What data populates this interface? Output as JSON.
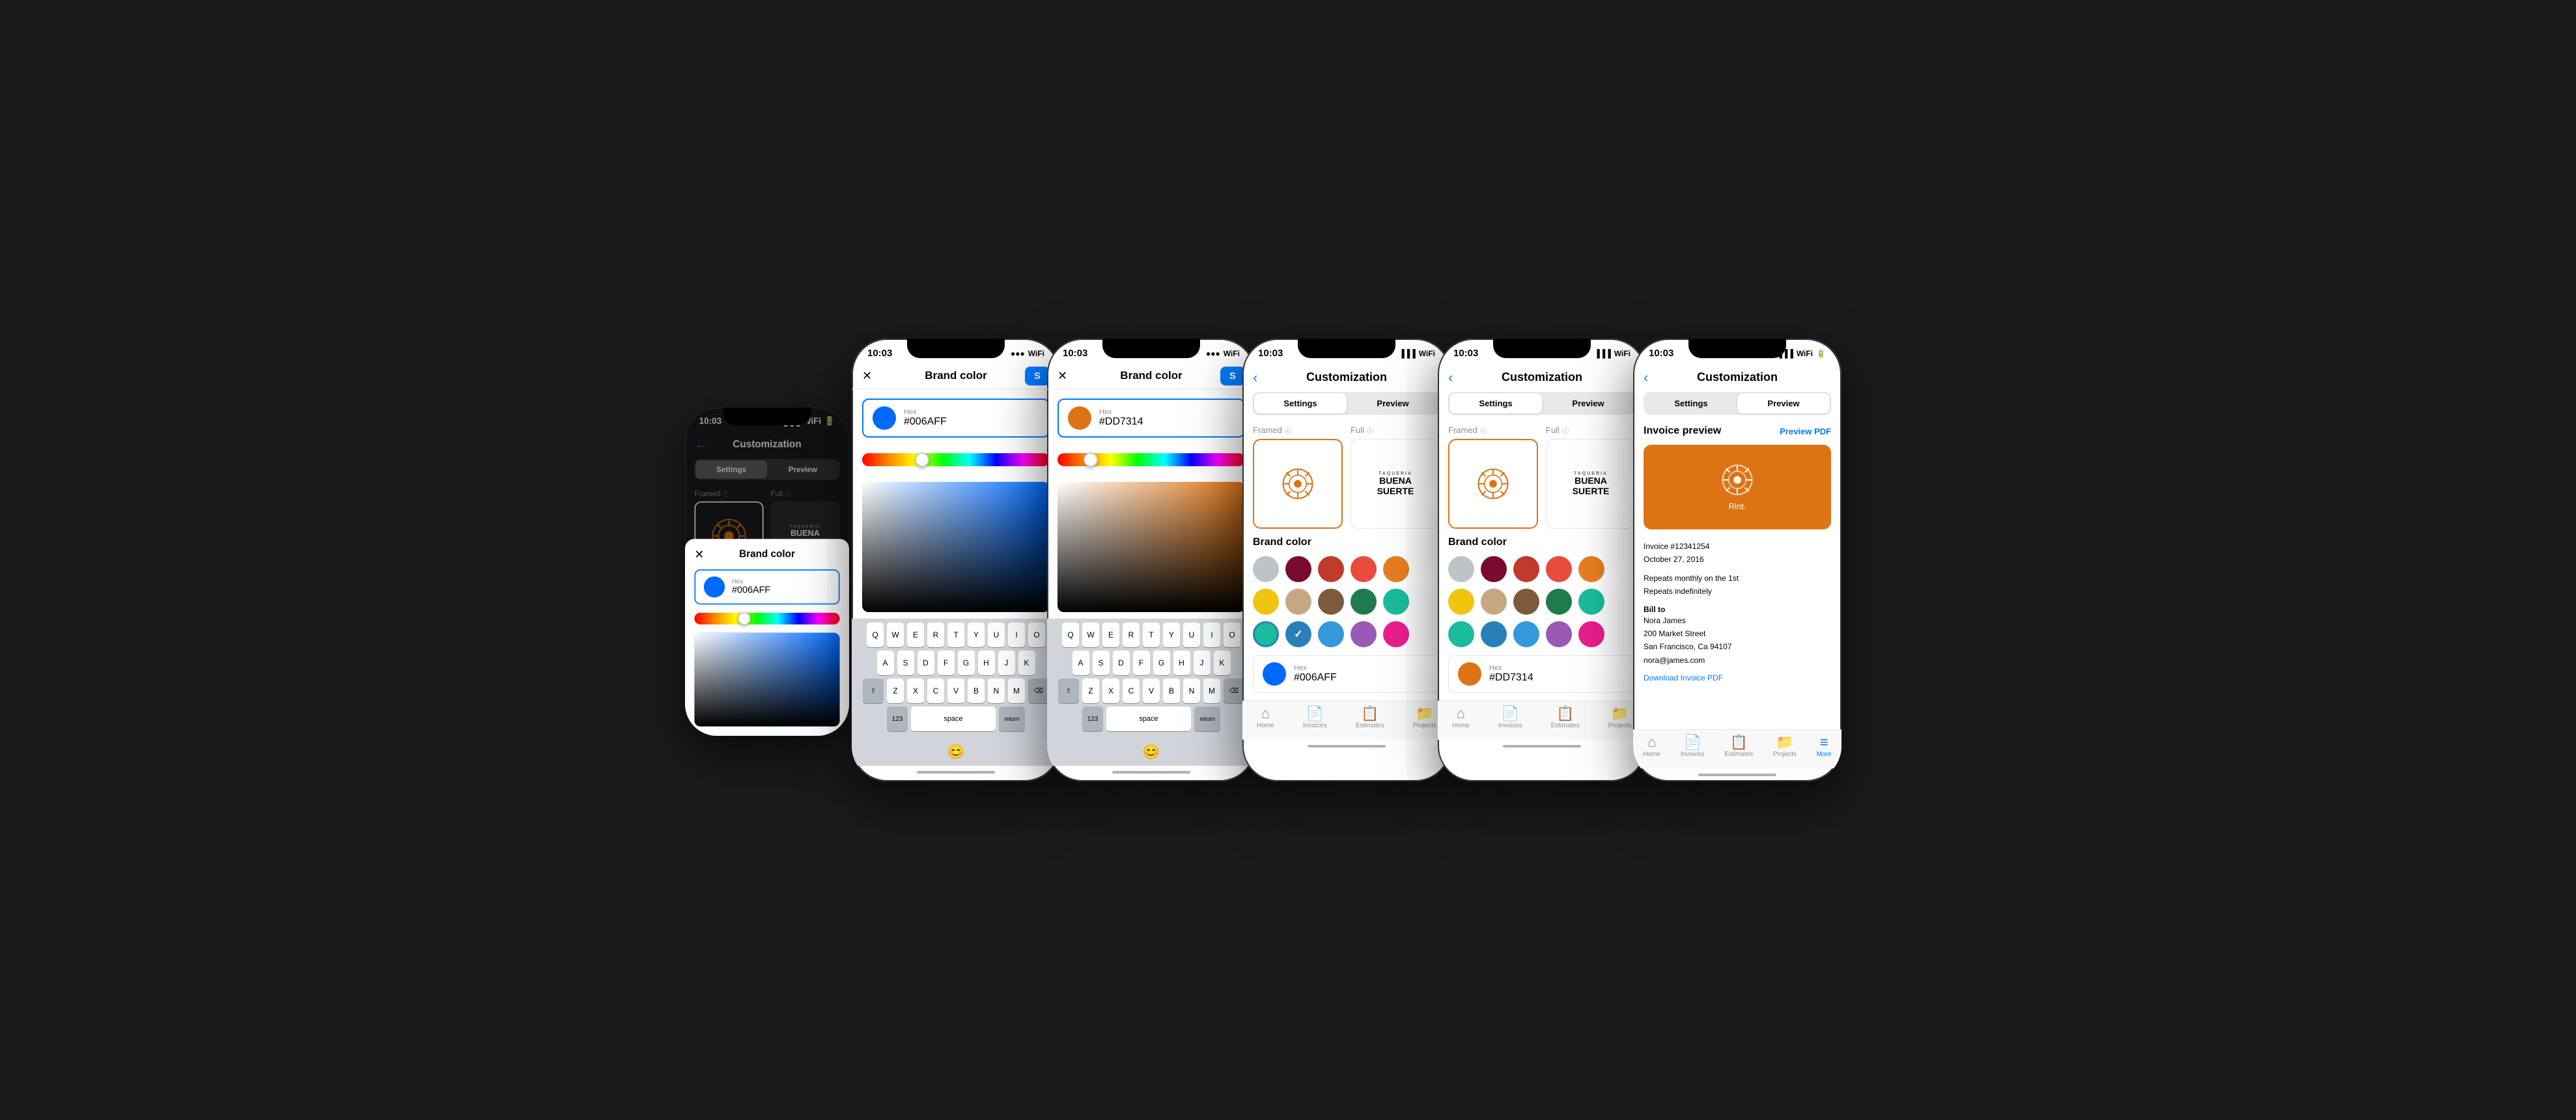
{
  "screens": {
    "screen1": {
      "time": "10:03",
      "title": "Customization",
      "tabs": [
        "Settings",
        "Preview"
      ],
      "activeTab": 0,
      "logoLabel": "Framed",
      "fullLabel": "Full",
      "brandColorLabel": "Brand color",
      "modal": {
        "title": "Brand color",
        "hexLabel": "Hex",
        "hexValue": "#006AFF",
        "color": "#006AFF",
        "sliderPosition": "30%"
      }
    },
    "screen2": {
      "time": "10:03",
      "title": "Brand color",
      "hexLabel": "Hex",
      "hexValue": "#006AFF",
      "color": "#006AFF",
      "sliderPosition": "30%"
    },
    "screen3": {
      "time": "10:03",
      "title": "Brand color",
      "hexLabel": "Hex",
      "hexValue": "#DD7314",
      "color": "#DD7314",
      "sliderPosition": "15%"
    },
    "screen4": {
      "time": "10:03",
      "title": "Customization",
      "tabs": [
        "Settings",
        "Preview"
      ],
      "activeTab": 0,
      "brandColorLabel": "Brand color",
      "hexLabel": "Hex",
      "hexValue": "#006AFF",
      "selectedColor": "#006AFF"
    },
    "screen5": {
      "time": "10:03",
      "title": "Customization",
      "tabs": [
        "Settings",
        "Preview"
      ],
      "activeTab": 0,
      "brandColorLabel": "Brand color",
      "hexLabel": "Hex",
      "hexValue": "#DD7314",
      "selectedColor": "#DD7314"
    },
    "screen6": {
      "time": "10:03",
      "title": "Customization",
      "tabs": [
        "Settings",
        "Preview"
      ],
      "activeTab": 1,
      "invoicePreviewLabel": "Invoice preview",
      "previewPdfLabel": "Preview PDF",
      "invoiceNumber": "Invoice #12341254",
      "invoiceDate": "October 27, 2016",
      "repeatLine1": "Repeats monthly on the 1st",
      "repeatLine2": "Repeats indefinitely",
      "billToLabel": "Bill to",
      "clientName": "Nora James",
      "addressLine1": "200 Market Street",
      "addressLine2": "San Francisco, Ca 94107",
      "email": "nora@james.com",
      "downloadLabel": "Download Invoice PDF"
    }
  },
  "nav": {
    "items": [
      "Home",
      "Invoices",
      "Estimates",
      "Projects",
      "More"
    ],
    "icons": [
      "⌂",
      "≡",
      "📋",
      "📁",
      "•••"
    ]
  },
  "colors": {
    "brand_blue": "#006AFF",
    "brand_orange": "#DD7314",
    "gray": "#8e8e93",
    "light_gray": "#c7c7cc",
    "dark_red": "#7a0a2e",
    "red": "#c0392b",
    "coral": "#e74c3c",
    "salmon": "#f39c12",
    "orange": "#e67e22",
    "silver": "#bdc3c7",
    "dark_maroon": "#6d1a36",
    "crimson": "#c0122b",
    "orange2": "#e55c26",
    "yellow": "#f1c40f",
    "tan": "#c4a882",
    "brown": "#7d5a3c",
    "dark_green": "#1e7b4d",
    "teal": "#1abc9c",
    "green": "#27ae60",
    "blue_checked": "#2980b9",
    "blue2": "#3498db",
    "purple": "#9b59b6",
    "pink": "#e91e8c"
  }
}
